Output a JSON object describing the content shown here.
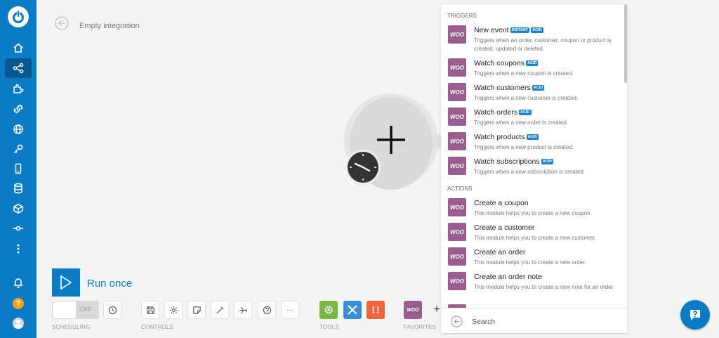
{
  "sidebar": {
    "items": [
      {
        "name": "home-icon"
      },
      {
        "name": "share-icon"
      },
      {
        "name": "puzzle-icon"
      },
      {
        "name": "link-icon"
      },
      {
        "name": "globe-icon"
      },
      {
        "name": "key-icon"
      },
      {
        "name": "phone-icon"
      },
      {
        "name": "database-icon"
      },
      {
        "name": "cube-icon"
      },
      {
        "name": "flow-icon"
      },
      {
        "name": "more-vertical-icon"
      },
      {
        "name": "bell-icon"
      },
      {
        "name": "help-icon",
        "label": "?"
      },
      {
        "name": "avatar-icon"
      }
    ]
  },
  "header": {
    "title": "Empty integration"
  },
  "run": {
    "label": "Run once"
  },
  "scheduling": {
    "toggle_state": "OFF",
    "label": "SCHEDULING"
  },
  "controls": {
    "label": "CONTROLS",
    "more_label": "···"
  },
  "tools": {
    "label": "TOOLS",
    "bracket_label": "[ ]"
  },
  "favorites": {
    "label": "FAVORITES",
    "woo_label": "WOO",
    "add_label": "+"
  },
  "colors": {
    "brand": "#0a7bc4",
    "woo": "#9b5c8f",
    "tools_green": "#7ab648",
    "tools_blue": "#3b8fd9",
    "tools_red": "#f0653b"
  },
  "panel": {
    "triggers_label": "TRIGGERS",
    "actions_label": "ACTIONS",
    "icon_label": "WOO",
    "triggers": [
      {
        "title": "New event",
        "badges": [
          "INSTANT",
          "ACID"
        ],
        "desc": "Triggers when an order, customer, coupon or product is created, updated or deleted."
      },
      {
        "title": "Watch coupons",
        "badges": [
          "ACID"
        ],
        "desc": "Triggers when a new coupon is created."
      },
      {
        "title": "Watch customers",
        "badges": [
          "ACID"
        ],
        "desc": "Triggers when a new customer is created."
      },
      {
        "title": "Watch orders",
        "badges": [
          "ACID"
        ],
        "desc": "Triggers when a new order is created."
      },
      {
        "title": "Watch products",
        "badges": [
          "ACID"
        ],
        "desc": "Triggers when a new product is created."
      },
      {
        "title": "Watch subscriptions",
        "badges": [
          "ACID"
        ],
        "desc": "Triggers when a new subscription is created."
      }
    ],
    "actions": [
      {
        "title": "Create a coupon",
        "desc": "This module helps you to create a new coupon."
      },
      {
        "title": "Create a customer",
        "desc": "This module helps you to create a new customer."
      },
      {
        "title": "Create an order",
        "desc": "This module helps you to create a new order."
      },
      {
        "title": "Create an order note",
        "desc": "This module helps you to create a new note for an order."
      }
    ],
    "search_placeholder": "Search"
  }
}
